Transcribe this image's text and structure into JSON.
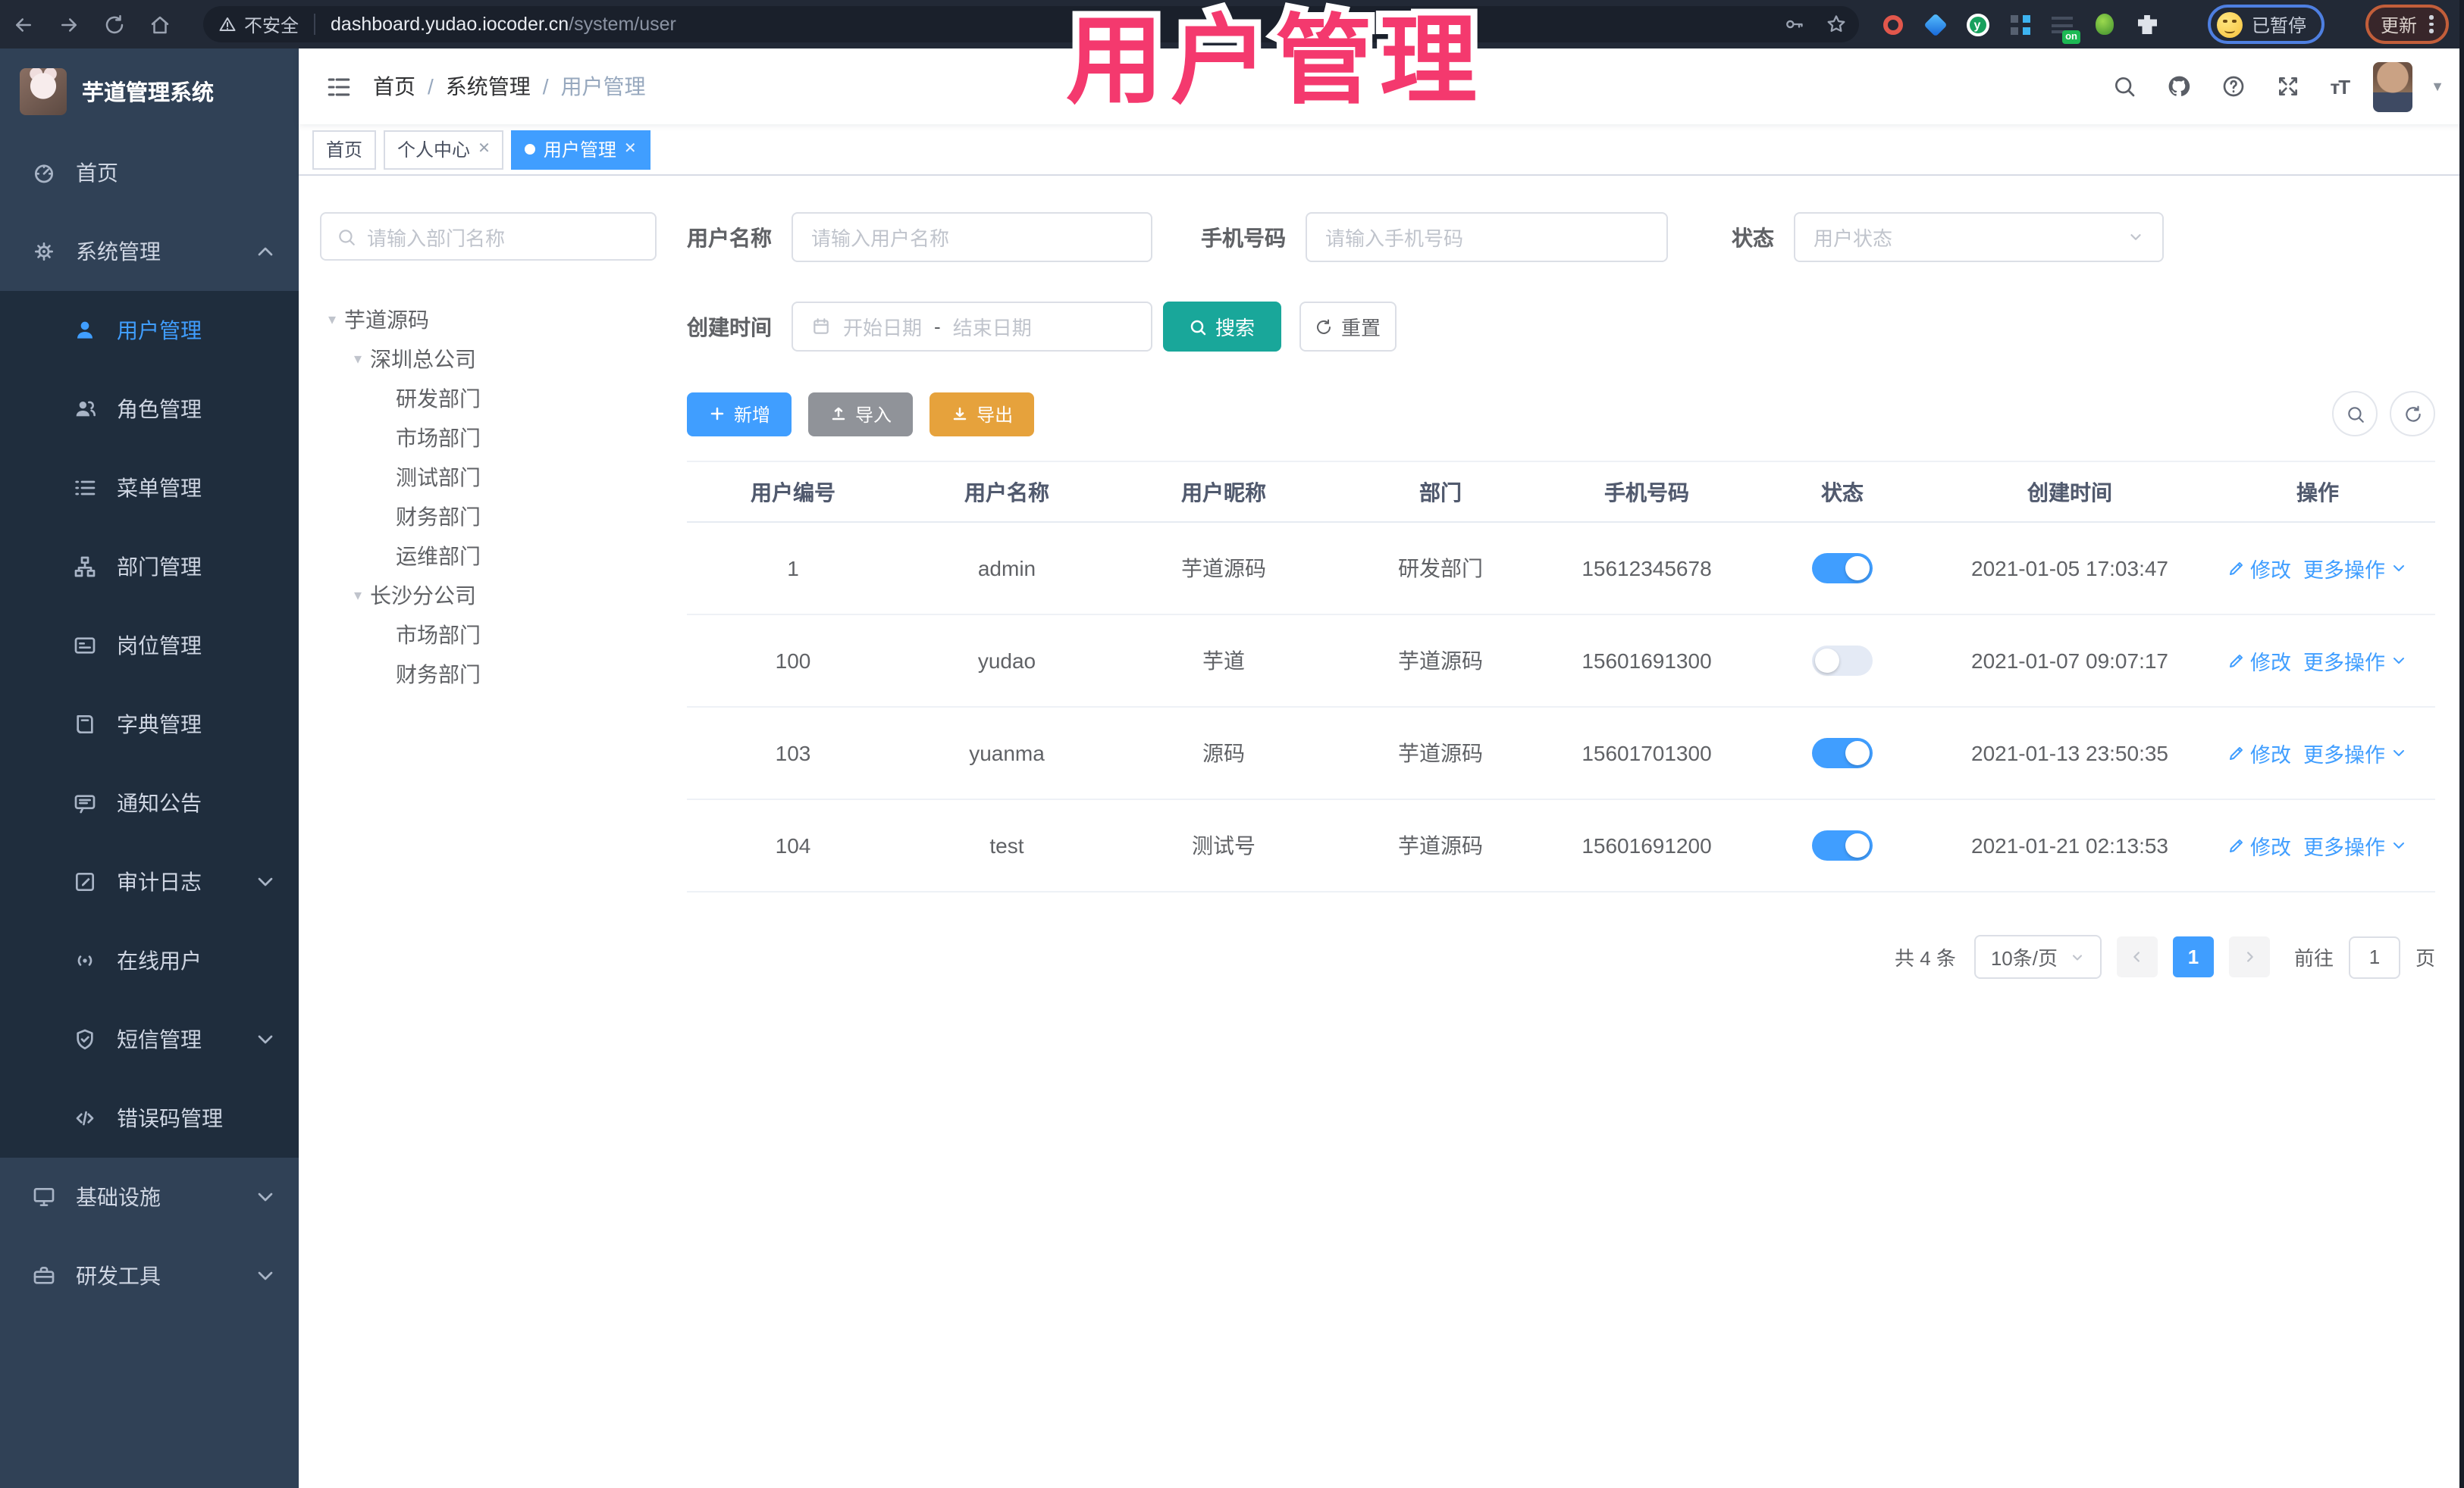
{
  "browser": {
    "security_label": "不安全",
    "url_domain": "dashboard.yudao.iocoder.cn",
    "url_path": "/system/user",
    "extension_badge": "on",
    "profile_status": "已暂停",
    "update_label": "更新"
  },
  "overlay_title": "用户管理",
  "sidebar": {
    "app_title": "芋道管理系统",
    "items": [
      {
        "key": "home",
        "label": "首页",
        "icon": "dashboard-icon",
        "type": "top"
      },
      {
        "key": "system-management",
        "label": "系统管理",
        "icon": "gear-icon",
        "type": "top",
        "arrow": "up"
      },
      {
        "key": "user-management",
        "label": "用户管理",
        "icon": "user-icon",
        "type": "sub",
        "active": true
      },
      {
        "key": "role-management",
        "label": "角色管理",
        "icon": "users-icon",
        "type": "sub"
      },
      {
        "key": "menu-management",
        "label": "菜单管理",
        "icon": "menu-list-icon",
        "type": "sub"
      },
      {
        "key": "dept-management",
        "label": "部门管理",
        "icon": "org-tree-icon",
        "type": "sub"
      },
      {
        "key": "post-management",
        "label": "岗位管理",
        "icon": "id-card-icon",
        "type": "sub"
      },
      {
        "key": "dict-management",
        "label": "字典管理",
        "icon": "dictionary-icon",
        "type": "sub"
      },
      {
        "key": "notice",
        "label": "通知公告",
        "icon": "announcement-icon",
        "type": "sub"
      },
      {
        "key": "audit-log",
        "label": "审计日志",
        "icon": "audit-log-icon",
        "type": "sub",
        "arrow": "down"
      },
      {
        "key": "online-users",
        "label": "在线用户",
        "icon": "online-users-icon",
        "type": "sub"
      },
      {
        "key": "sms-management",
        "label": "短信管理",
        "icon": "sms-shield-icon",
        "type": "sub",
        "arrow": "down"
      },
      {
        "key": "error-code-management",
        "label": "错误码管理",
        "icon": "error-code-icon",
        "type": "sub"
      },
      {
        "key": "infrastructure",
        "label": "基础设施",
        "icon": "infrastructure-icon",
        "type": "top",
        "arrow": "down"
      },
      {
        "key": "dev-tools",
        "label": "研发工具",
        "icon": "dev-tools-icon",
        "type": "top",
        "arrow": "down"
      }
    ]
  },
  "breadcrumb": {
    "items": [
      "首页",
      "系统管理",
      "用户管理"
    ]
  },
  "tabs": [
    {
      "label": "首页",
      "closable": false,
      "active": false
    },
    {
      "label": "个人中心",
      "closable": true,
      "active": false
    },
    {
      "label": "用户管理",
      "closable": true,
      "active": true
    }
  ],
  "dept_panel": {
    "search_placeholder": "请输入部门名称",
    "tree": [
      {
        "label": "芋道源码",
        "level": 0,
        "expandable": true
      },
      {
        "label": "深圳总公司",
        "level": 1,
        "expandable": true
      },
      {
        "label": "研发部门",
        "level": 2
      },
      {
        "label": "市场部门",
        "level": 2
      },
      {
        "label": "测试部门",
        "level": 2
      },
      {
        "label": "财务部门",
        "level": 2
      },
      {
        "label": "运维部门",
        "level": 2
      },
      {
        "label": "长沙分公司",
        "level": 1,
        "expandable": true
      },
      {
        "label": "市场部门",
        "level": 2
      },
      {
        "label": "财务部门",
        "level": 2
      }
    ]
  },
  "filter": {
    "username_label": "用户名称",
    "username_placeholder": "请输入用户名称",
    "mobile_label": "手机号码",
    "mobile_placeholder": "请输入手机号码",
    "status_label": "状态",
    "status_placeholder": "用户状态",
    "create_time_label": "创建时间",
    "start_placeholder": "开始日期",
    "range_separator": "-",
    "end_placeholder": "结束日期",
    "search_label": "搜索",
    "reset_label": "重置"
  },
  "toolbar": {
    "add_label": "新增",
    "import_label": "导入",
    "export_label": "导出"
  },
  "table": {
    "headers": [
      "用户编号",
      "用户名称",
      "用户昵称",
      "部门",
      "手机号码",
      "状态",
      "创建时间",
      "操作"
    ],
    "edit_label": "修改",
    "more_label": "更多操作",
    "rows": [
      {
        "id": "1",
        "username": "admin",
        "nickname": "芋道源码",
        "dept": "研发部门",
        "mobile": "15612345678",
        "status": true,
        "create_time": "2021-01-05 17:03:47"
      },
      {
        "id": "100",
        "username": "yudao",
        "nickname": "芋道",
        "dept": "芋道源码",
        "mobile": "15601691300",
        "status": false,
        "create_time": "2021-01-07 09:07:17"
      },
      {
        "id": "103",
        "username": "yuanma",
        "nickname": "源码",
        "dept": "芋道源码",
        "mobile": "15601701300",
        "status": true,
        "create_time": "2021-01-13 23:50:35"
      },
      {
        "id": "104",
        "username": "test",
        "nickname": "测试号",
        "dept": "芋道源码",
        "mobile": "15601691200",
        "status": true,
        "create_time": "2021-01-21 02:13:53"
      }
    ]
  },
  "pagination": {
    "total_label": "共 4 条",
    "page_size_label": "10条/页",
    "current_page": "1",
    "goto_label": "前往",
    "goto_value": "1",
    "page_unit_label": "页"
  },
  "colors": {
    "accent_blue": "#409eff",
    "search_teal": "#19a79a",
    "export_orange": "#e6a23c",
    "import_gray": "#909399",
    "title_pink": "#f4396e",
    "sidebar_bg": "#304156",
    "submenu_bg": "#1f2d3d",
    "browser_bar_bg": "#222936"
  }
}
